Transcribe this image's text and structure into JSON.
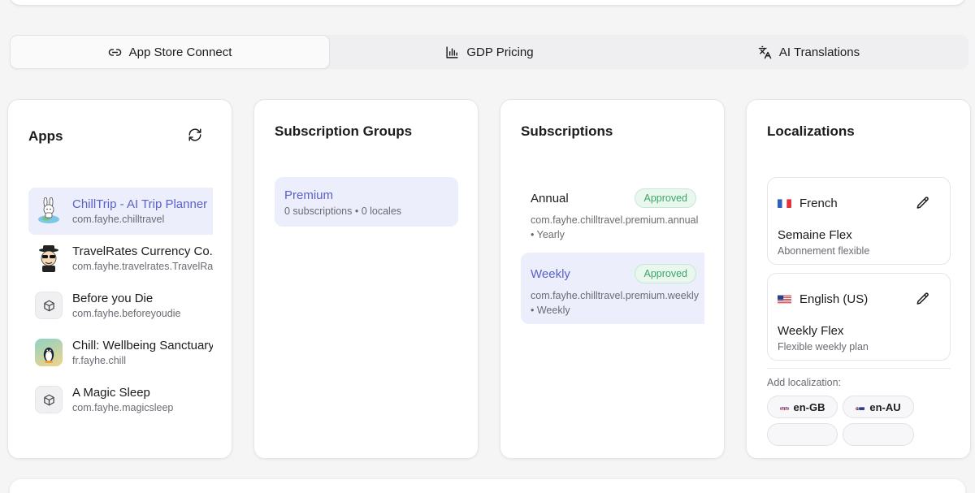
{
  "tabs": [
    {
      "label": "App Store Connect",
      "icon": "link-icon",
      "active": true
    },
    {
      "label": "GDP Pricing",
      "icon": "bar-chart-icon",
      "active": false
    },
    {
      "label": "AI Translations",
      "icon": "translate-icon",
      "active": false
    }
  ],
  "apps_panel": {
    "title": "Apps",
    "items": [
      {
        "name": "ChillTrip - AI Trip Planner",
        "bundle": "com.fayhe.chilltravel",
        "icon": "rabbit-globe-icon",
        "selected": true
      },
      {
        "name": "TravelRates Currency Co...",
        "bundle": "com.fayhe.travelrates.TravelRates",
        "icon": "spy-character-icon",
        "selected": false
      },
      {
        "name": "Before you Die",
        "bundle": "com.fayhe.beforeyoudie",
        "icon": "box-icon",
        "selected": false
      },
      {
        "name": "Chill: Wellbeing Sanctuary",
        "bundle": "fr.fayhe.chill",
        "icon": "penguin-icon",
        "selected": false
      },
      {
        "name": "A Magic Sleep",
        "bundle": "com.fayhe.magicsleep",
        "icon": "box-icon",
        "selected": false
      }
    ]
  },
  "groups_panel": {
    "title": "Subscription Groups",
    "groups": [
      {
        "name": "Premium",
        "meta": "0 subscriptions • 0 locales"
      }
    ]
  },
  "subs_panel": {
    "title": "Subscriptions",
    "items": [
      {
        "name": "Annual",
        "status": "Approved",
        "id": "com.fayhe.chilltravel.premium.annual",
        "period": "• Yearly",
        "selected": false
      },
      {
        "name": "Weekly",
        "status": "Approved",
        "id": "com.fayhe.chilltravel.premium.weekly",
        "period": "• Weekly",
        "selected": true
      }
    ]
  },
  "loc_panel": {
    "title": "Localizations",
    "items": [
      {
        "language": "French",
        "flag": "fr",
        "title": "Semaine Flex",
        "desc": "Abonnement flexible"
      },
      {
        "language": "English (US)",
        "flag": "us",
        "title": "Weekly Flex",
        "desc": "Flexible weekly plan"
      }
    ],
    "add_label": "Add localization:",
    "chips": [
      {
        "label": "en-GB",
        "flag": "gb"
      },
      {
        "label": "en-AU",
        "flag": "au"
      }
    ]
  },
  "colors": {
    "accent": "#5a61c9",
    "selected_bg": "#eceefc",
    "approved_text": "#3aa766",
    "approved_bg": "#e9f7ee"
  }
}
